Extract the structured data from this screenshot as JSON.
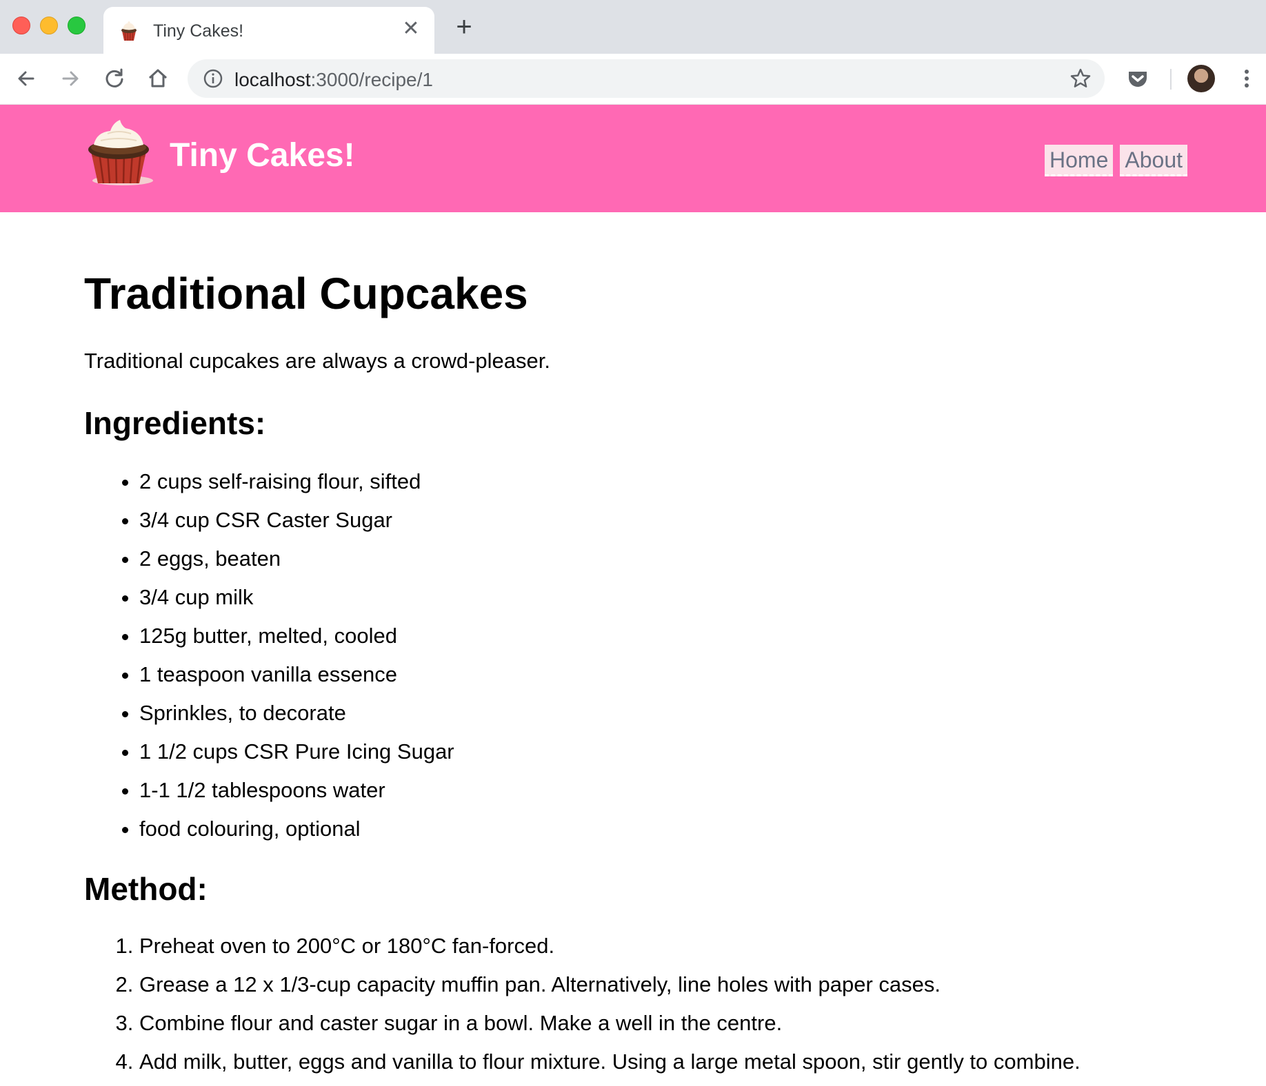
{
  "browser": {
    "tab_title": "Tiny Cakes!",
    "tab_close": "✕",
    "new_tab": "+",
    "url_host": "localhost",
    "url_path": ":3000/recipe/1"
  },
  "site": {
    "title": "Tiny Cakes!",
    "nav": [
      "Home",
      "About"
    ]
  },
  "recipe": {
    "title": "Traditional Cupcakes",
    "description": "Traditional cupcakes are always a crowd-pleaser.",
    "ingredients_heading": "Ingredients:",
    "ingredients": [
      "2 cups self-raising flour, sifted",
      "3/4 cup CSR Caster Sugar",
      "2 eggs, beaten",
      "3/4 cup milk",
      "125g butter, melted, cooled",
      "1 teaspoon vanilla essence",
      "Sprinkles, to decorate",
      "1 1/2 cups CSR Pure Icing Sugar",
      "1-1 1/2 tablespoons water",
      "food colouring, optional"
    ],
    "method_heading": "Method:",
    "method": [
      "Preheat oven to 200°C or 180°C fan-forced.",
      "Grease a 12 x 1/3-cup capacity muffin pan. Alternatively, line holes with paper cases.",
      "Combine flour and caster sugar in a bowl. Make a well in the centre.",
      "Add milk, butter, eggs and vanilla to flour mixture. Using a large metal spoon, stir gently to combine."
    ]
  },
  "icons": {
    "back": "back-arrow-icon",
    "forward": "forward-arrow-icon",
    "reload": "reload-icon",
    "home": "home-icon",
    "info": "info-icon",
    "bookmark": "star-icon",
    "pocket": "pocket-icon",
    "menu": "kebab-menu-icon",
    "logo": "cupcake-icon"
  },
  "colors": {
    "header_bg": "#ff69b4",
    "nav_link_bg": "#fbe3ea",
    "nav_link_text": "#6a7285"
  }
}
